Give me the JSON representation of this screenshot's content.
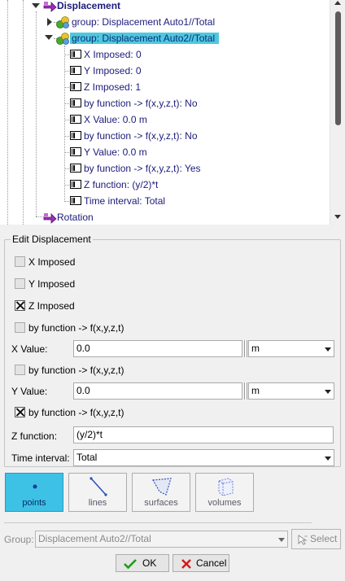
{
  "tree": {
    "displacement_label": "Displacement",
    "group1_label": "group: Displacement Auto1//Total",
    "group2_label": "group: Displacement Auto2//Total",
    "conditions": [
      "X Imposed: 0",
      "Y Imposed: 0",
      "Z Imposed: 1",
      "by function -> f(x,y,z,t): No",
      "X Value: 0.0 m",
      "by function -> f(x,y,z,t): No",
      "Y Value: 0.0 m",
      "by function -> f(x,y,z,t): Yes",
      "Z function: (y/2)*t",
      "Time interval: Total"
    ],
    "rotation_label": "Rotation"
  },
  "edit": {
    "title": "Edit Displacement",
    "x_imposed": {
      "label": "X Imposed",
      "checked": false
    },
    "y_imposed": {
      "label": "Y Imposed",
      "checked": false
    },
    "z_imposed": {
      "label": "Z Imposed",
      "checked": true
    },
    "x_by_function": {
      "label": "by function -> f(x,y,z,t)",
      "checked": false
    },
    "x_value": {
      "label": "X Value:",
      "value": "0.0",
      "unit": "m"
    },
    "y_by_function": {
      "label": "by function -> f(x,y,z,t)",
      "checked": false
    },
    "y_value": {
      "label": "Y Value:",
      "value": "0.0",
      "unit": "m"
    },
    "z_by_function": {
      "label": "by function -> f(x,y,z,t)",
      "checked": true
    },
    "z_function": {
      "label": "Z function:",
      "value": "(y/2)*t"
    },
    "time_interval": {
      "label": "Time interval:",
      "value": "Total"
    }
  },
  "entities": [
    {
      "label": "points",
      "icon": "points-icon",
      "active": true
    },
    {
      "label": "lines",
      "icon": "lines-icon",
      "active": false
    },
    {
      "label": "surfaces",
      "icon": "surfaces-icon",
      "active": false
    },
    {
      "label": "volumes",
      "icon": "volumes-icon",
      "active": false
    }
  ],
  "bottom": {
    "group_label": "Group:",
    "group_value": "Displacement Auto2//Total",
    "select_label": "Select",
    "ok_label": "OK",
    "cancel_label": "Cancel"
  },
  "colors": {
    "selection": "#4fc8df",
    "active_entity": "#3dc2e6",
    "tree_text": "#1b1b7a",
    "ok_check": "#1e9b1e",
    "cancel_x": "#d11a1a"
  }
}
